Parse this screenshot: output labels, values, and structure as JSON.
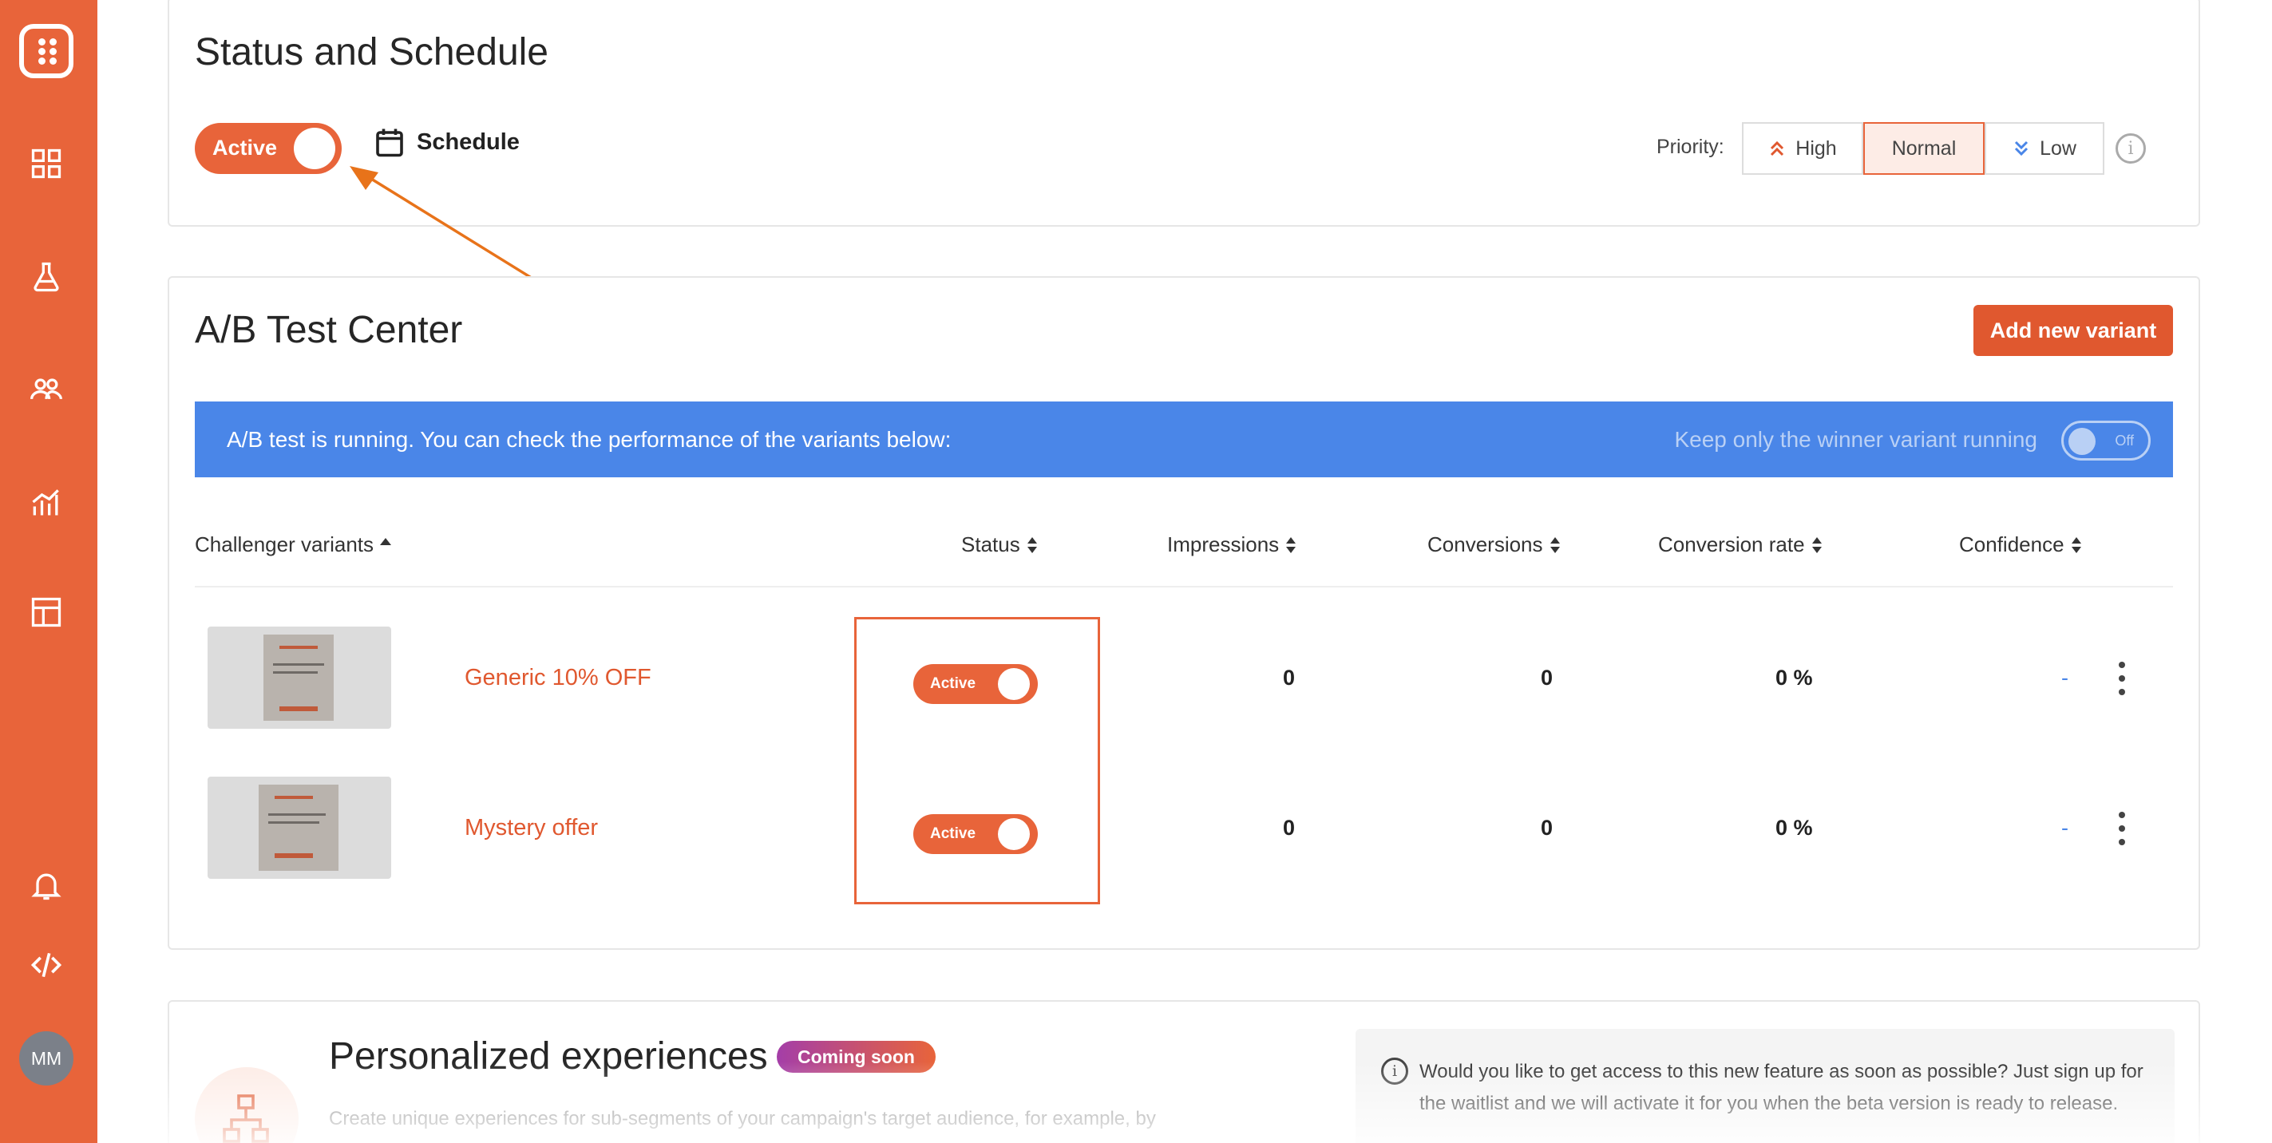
{
  "sidebar": {
    "icons": [
      "grid-icon",
      "flask-icon",
      "users-icon",
      "analytics-icon",
      "layout-icon",
      "bell-icon",
      "code-icon"
    ],
    "avatar_initials": "MM"
  },
  "status_schedule": {
    "title": "Status and Schedule",
    "status_toggle_label": "Active",
    "schedule_label": "Schedule",
    "priority_label": "Priority:",
    "priority_options": [
      "High",
      "Normal",
      "Low"
    ],
    "priority_selected": "Normal"
  },
  "ab_test": {
    "title": "A/B Test Center",
    "add_variant_label": "Add new variant",
    "banner_text": "A/B test is running. You can check the performance of the variants below:",
    "keep_winner_label": "Keep only the winner variant running",
    "keep_winner_toggle": "Off",
    "columns": [
      "Challenger variants",
      "Status",
      "Impressions",
      "Conversions",
      "Conversion rate",
      "Confidence"
    ],
    "variants": [
      {
        "name": "Generic 10% OFF",
        "status": "Active",
        "impressions": "0",
        "conversions": "0",
        "conversion_rate": "0 %",
        "confidence": "-"
      },
      {
        "name": "Mystery offer",
        "status": "Active",
        "impressions": "0",
        "conversions": "0",
        "conversion_rate": "0 %",
        "confidence": "-"
      }
    ]
  },
  "personalized": {
    "title": "Personalized experiences",
    "badge": "Coming soon",
    "description": "Create unique experiences for sub-segments of your campaign's target audience, for example, by",
    "waitlist_text": "Would you like to get access to this new feature as soon as possible? Just sign up for the waitlist and we will activate it for you when the beta version is ready to release."
  },
  "colors": {
    "brand": "#e8643a",
    "banner": "#4a86e8"
  }
}
